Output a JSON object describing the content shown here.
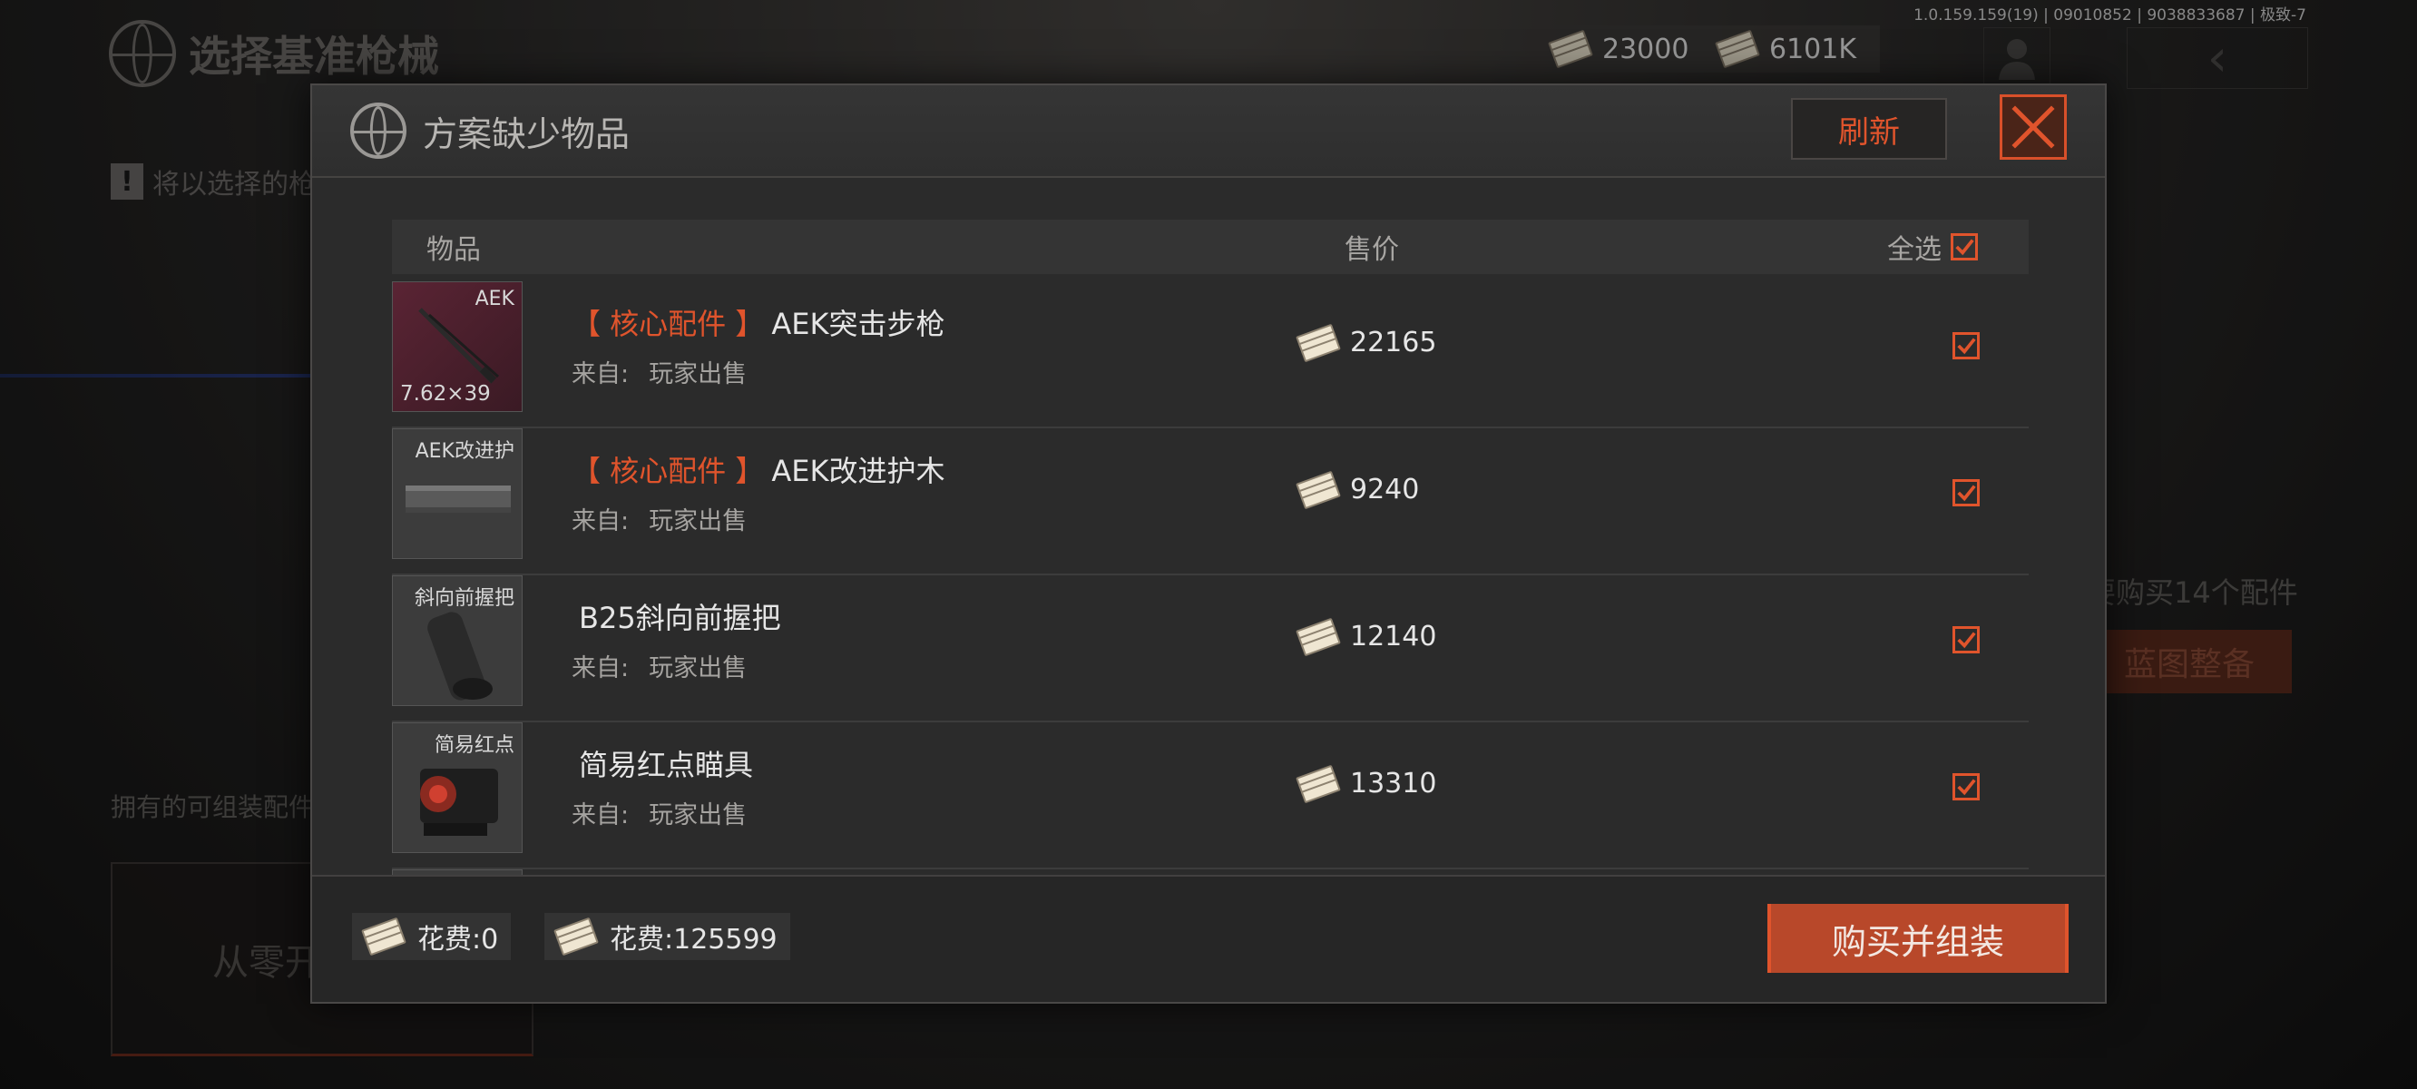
{
  "background": {
    "title": "选择基准枪械",
    "hint": "将以选择的枪",
    "owned_label": "拥有的可组装配件",
    "scratch_label": "从零开",
    "buy_hint": "要购买14个配件",
    "blueprint_button": "蓝图整备",
    "version": "1.0.159.159(19) | 09010852 | 9038833687 | 极致-7",
    "currency": [
      {
        "icon": "money-icon",
        "value": "23000"
      },
      {
        "icon": "money-icon",
        "value": "6101K"
      }
    ],
    "back_icon": "‹"
  },
  "dialog": {
    "title": "方案缺少物品",
    "refresh_label": "刷新",
    "columns": {
      "item": "物品",
      "price": "售价",
      "select_all": "全选"
    },
    "select_all_checked": true,
    "rows": [
      {
        "tag": "【 核心配件 】",
        "name": "AEK突击步枪",
        "source_label": "来自:",
        "source": "玩家出售",
        "price": "22165",
        "thumb_label": "AEK",
        "thumb_sub": "7.62×39",
        "checked": true
      },
      {
        "tag": "【 核心配件 】",
        "name": "AEK改进护木",
        "source_label": "来自:",
        "source": "玩家出售",
        "price": "9240",
        "thumb_label": "AEK改进护",
        "thumb_sub": "",
        "checked": true
      },
      {
        "tag": "",
        "name": "B25斜向前握把",
        "source_label": "来自:",
        "source": "玩家出售",
        "price": "12140",
        "thumb_label": "斜向前握把",
        "thumb_sub": "",
        "checked": true
      },
      {
        "tag": "",
        "name": "简易红点瞄具",
        "source_label": "来自:",
        "source": "玩家出售",
        "price": "13310",
        "thumb_label": "简易红点",
        "thumb_sub": "",
        "checked": true
      },
      {
        "tag": "",
        "name": "",
        "source_label": "",
        "source": "",
        "price": "",
        "thumb_label": "",
        "thumb_sub": "",
        "checked": false
      }
    ],
    "costs": [
      {
        "label": "花费:0"
      },
      {
        "label": "花费:125599"
      }
    ],
    "buy_label": "购买并组装"
  },
  "colors": {
    "accent": "#e0542c",
    "button": "#b8482a",
    "panel": "#2b2b2b"
  }
}
